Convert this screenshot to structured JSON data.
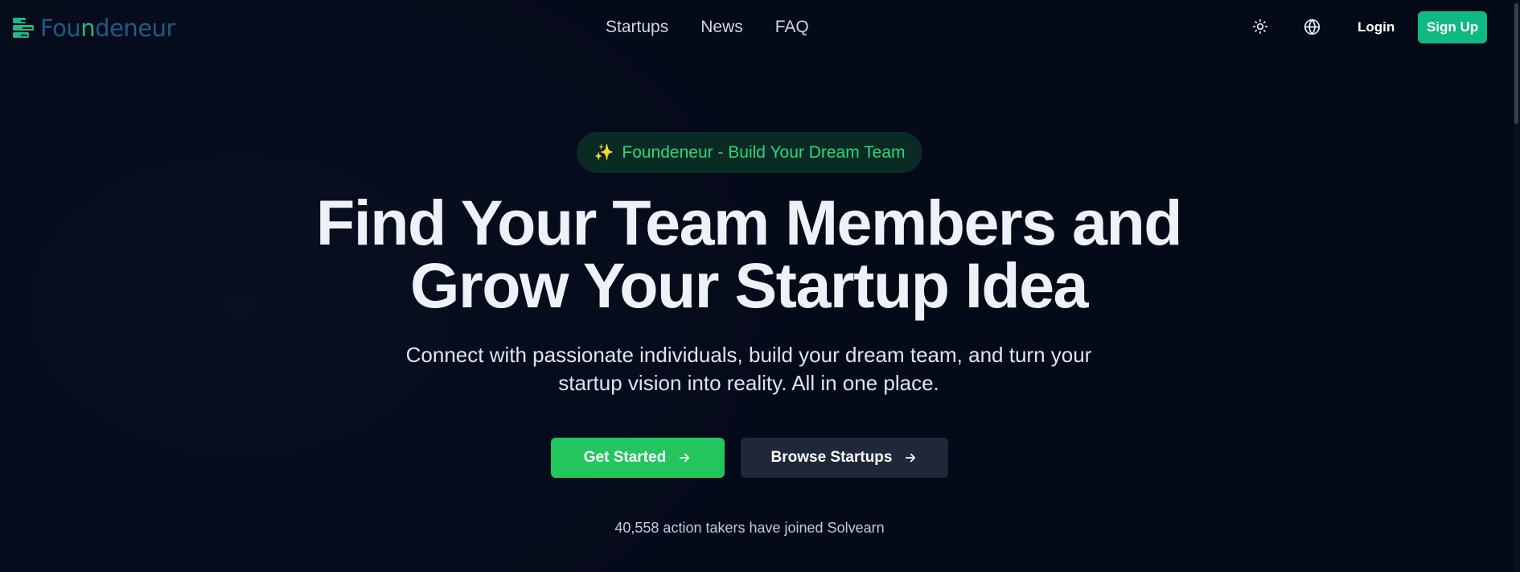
{
  "brand": {
    "name_prefix": "Fou",
    "name_accent": "n",
    "name_suffix": "deneur",
    "colors": {
      "primary": "#1f5a88",
      "accent": "#1fb985"
    }
  },
  "nav": {
    "links": [
      "Startups",
      "News",
      "FAQ"
    ]
  },
  "header_actions": {
    "theme_icon": "sun-icon",
    "language_icon": "globe-icon",
    "login_label": "Login",
    "signup_label": "Sign Up"
  },
  "hero": {
    "badge_icon": "sparkles-icon",
    "badge_text": "Foundeneur - Build Your Dream Team",
    "title_line1": "Find Your Team Members and",
    "title_line2": "Grow Your Startup Idea",
    "subtitle_line1": "Connect with passionate individuals, build your dream team, and turn your",
    "subtitle_line2": "startup vision into reality. All in one place.",
    "primary_button": "Get Started",
    "secondary_button": "Browse Startups",
    "button_icon": "arrow-right-icon",
    "joined_text": "40,558 action takers have joined Solvearn"
  },
  "colors": {
    "background": "#050a19",
    "green": "#22c55e",
    "signup": "#10b981",
    "secondary_button": "#1f2838"
  }
}
